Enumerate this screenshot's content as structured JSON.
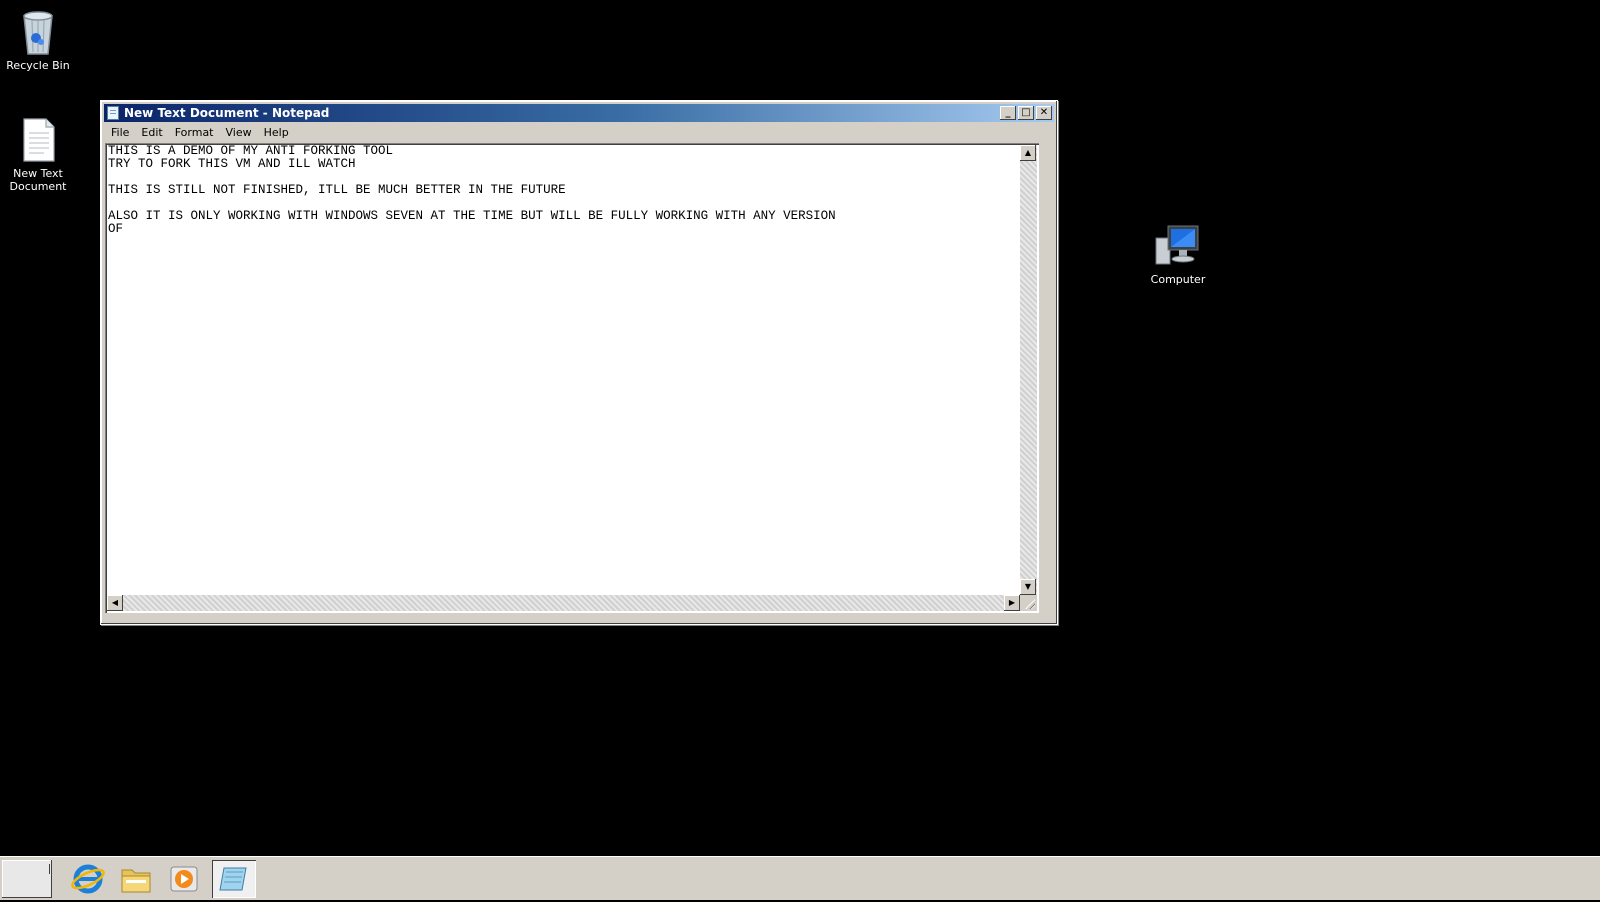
{
  "desktop": {
    "icons": [
      {
        "label": "Recycle Bin",
        "icon": "recycle-bin-icon"
      },
      {
        "label": "New Text\nDocument",
        "icon": "text-document-icon"
      },
      {
        "label": "Computer",
        "icon": "computer-icon"
      }
    ]
  },
  "window": {
    "title": "New Text Document - Notepad",
    "buttons": {
      "minimize": "_",
      "maximize": "□",
      "close": "✕"
    },
    "menu": [
      "File",
      "Edit",
      "Format",
      "View",
      "Help"
    ],
    "content": "THIS IS A DEMO OF MY ANTI FORKING TOOL\nTRY TO FORK THIS VM AND ILL WATCH\n\nTHIS IS STILL NOT FINISHED, ITLL BE MUCH BETTER IN THE FUTURE\n\nALSO IT IS ONLY WORKING WITH WINDOWS SEVEN AT THE TIME BUT WILL BE FULLY WORKING WITH ANY VERSION\nOF",
    "scroll_arrows": {
      "up": "▲",
      "down": "▼",
      "left": "◀",
      "right": "▶"
    }
  },
  "taskbar": {
    "items": [
      {
        "icon": "internet-explorer-icon"
      },
      {
        "icon": "file-explorer-icon"
      },
      {
        "icon": "media-player-icon"
      },
      {
        "icon": "notepad-icon",
        "active": true
      }
    ]
  },
  "colors": {
    "desktop_background": "#000000",
    "titlebar_start": "#0a246a",
    "titlebar_end": "#a6caf0",
    "window_face": "#d4d0c8"
  }
}
